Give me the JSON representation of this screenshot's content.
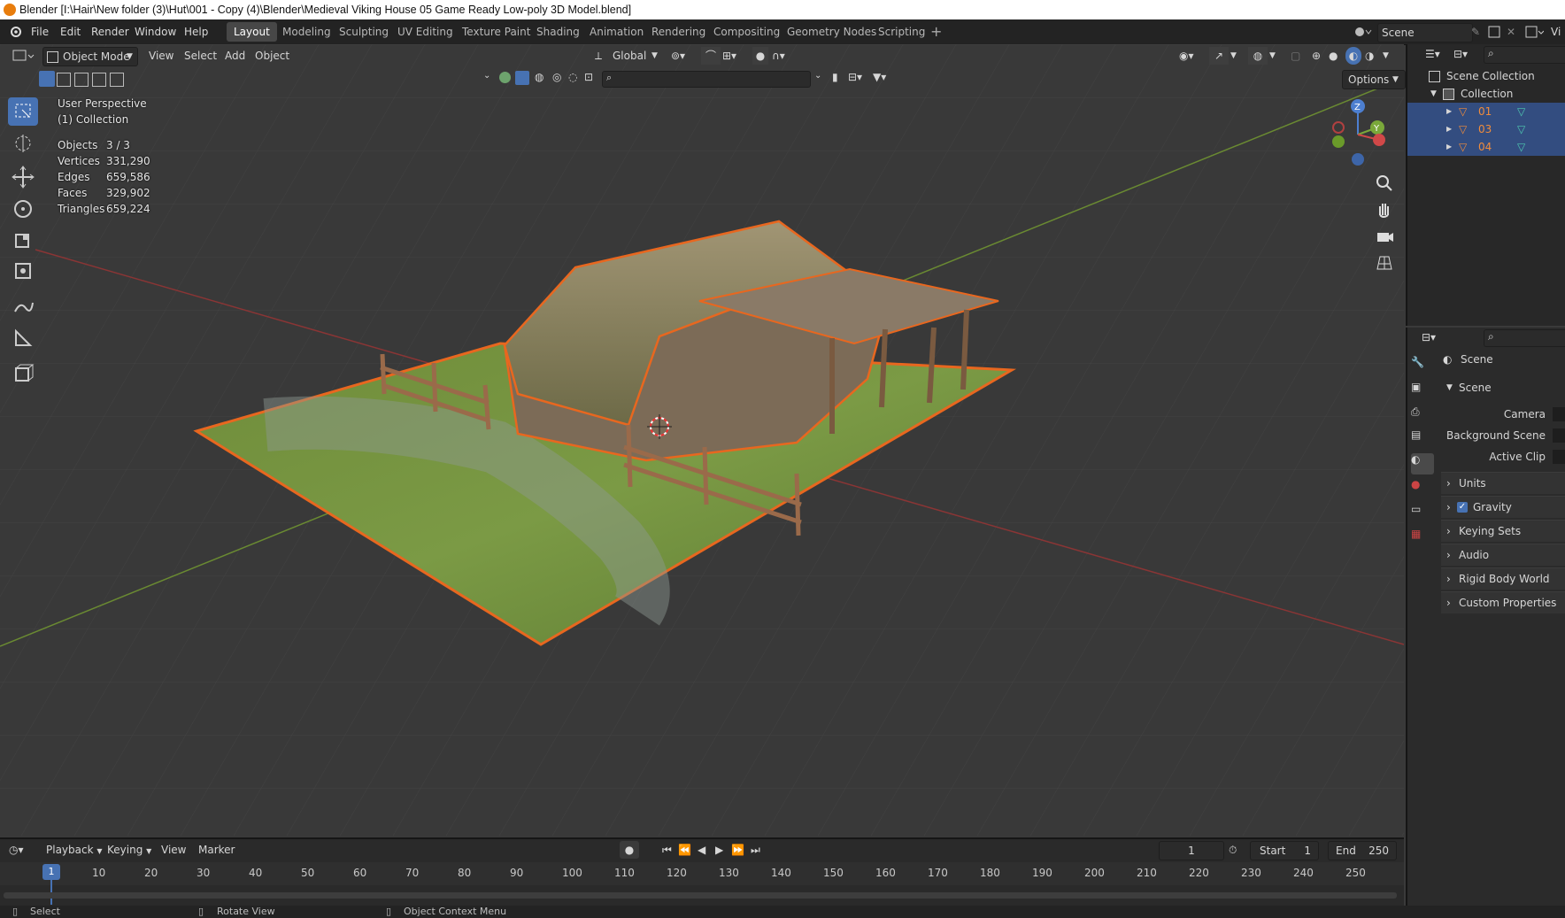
{
  "window": {
    "title": "Blender [I:\\Hair\\New folder (3)\\Hut\\001 - Copy (4)\\Blender\\Medieval Viking House 05 Game Ready Low-poly 3D Model.blend]"
  },
  "menu": [
    "File",
    "Edit",
    "Render",
    "Window",
    "Help"
  ],
  "workspaces": [
    "Layout",
    "Modeling",
    "Sculpting",
    "UV Editing",
    "Texture Paint",
    "Shading",
    "Animation",
    "Rendering",
    "Compositing",
    "Geometry Nodes",
    "Scripting"
  ],
  "active_workspace": "Layout",
  "scene_field": "Scene",
  "scene_field_trail": "Vi",
  "viewport_header": {
    "mode": "Object Mode",
    "menus": [
      "View",
      "Select",
      "Add",
      "Object"
    ],
    "orientation": "Global",
    "options": "Options"
  },
  "overlay": {
    "perspective": "User Perspective",
    "collection": "(1) Collection",
    "stats": [
      {
        "label": "Objects",
        "value": "3 / 3"
      },
      {
        "label": "Vertices",
        "value": "331,290"
      },
      {
        "label": "Edges",
        "value": "659,586"
      },
      {
        "label": "Faces",
        "value": "329,902"
      },
      {
        "label": "Triangles",
        "value": "659,224"
      }
    ]
  },
  "gizmo": {
    "z": "Z",
    "y": "Y"
  },
  "outliner": {
    "scene_collection": "Scene Collection",
    "collection": "Collection",
    "objects": [
      "01",
      "03",
      "04"
    ]
  },
  "properties": {
    "context": "Scene",
    "section": "Scene",
    "fields": [
      "Camera",
      "Background Scene",
      "Active Clip"
    ],
    "panels": [
      "Units",
      "Gravity",
      "Keying Sets",
      "Audio",
      "Rigid Body World",
      "Custom Properties"
    ],
    "gravity_checked": true
  },
  "timeline": {
    "menus": [
      "Playback",
      "Keying",
      "View",
      "Marker"
    ],
    "current_frame": "1",
    "start_label": "Start",
    "start": "1",
    "end_label": "End",
    "end": "250",
    "ticks": [
      "10",
      "20",
      "30",
      "40",
      "50",
      "60",
      "70",
      "80",
      "90",
      "100",
      "110",
      "120",
      "130",
      "140",
      "150",
      "160",
      "170",
      "180",
      "190",
      "200",
      "210",
      "220",
      "230",
      "240",
      "250"
    ],
    "playhead": "1"
  },
  "status": [
    "Select",
    "Rotate View",
    "Object Context Menu"
  ],
  "colors": {
    "accent": "#4772b3",
    "selection": "#e8671f",
    "selected_text": "#f08c3c"
  }
}
